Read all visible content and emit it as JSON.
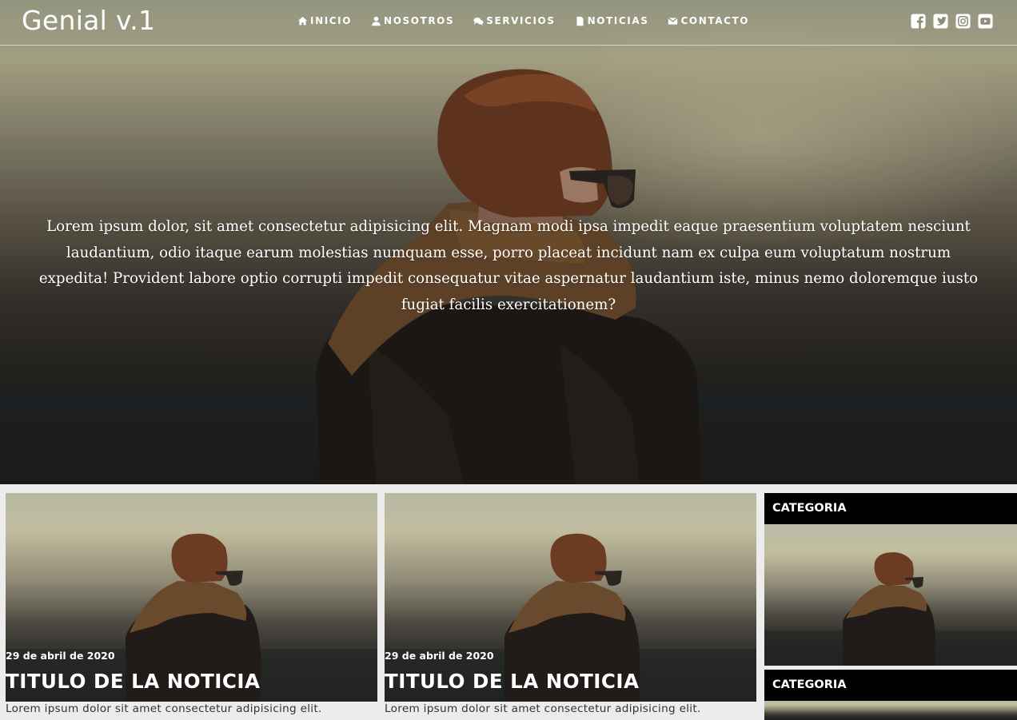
{
  "header": {
    "brand": "Genial v.1",
    "nav": [
      {
        "label": "INICIO",
        "icon": "home-icon"
      },
      {
        "label": "NOSOTROS",
        "icon": "user-icon"
      },
      {
        "label": "SERVICIOS",
        "icon": "comments-icon"
      },
      {
        "label": "NOTICIAS",
        "icon": "file-icon"
      },
      {
        "label": "CONTACTO",
        "icon": "envelope-icon"
      }
    ],
    "social": [
      "facebook-icon",
      "twitter-icon",
      "instagram-icon",
      "youtube-icon"
    ]
  },
  "hero": {
    "text": "Lorem ipsum dolor, sit amet consectetur adipisicing elit. Magnam modi ipsa impedit eaque praesentium voluptatem nesciunt laudantium, odio itaque earum molestias numquam esse, porro placeat incidunt nam ex culpa eum voluptatum nostrum expedita! Provident labore optio corrupti impedit consequatur vitae aspernatur laudantium iste, minus nemo doloremque iusto fugiat facilis exercitationem?"
  },
  "news": [
    {
      "date": "29 de abril de 2020",
      "title": "TITULO DE LA NOTICIA",
      "excerpt": "Lorem ipsum dolor sit amet consectetur adipisicing elit."
    },
    {
      "date": "29 de abril de 2020",
      "title": "TITULO DE LA NOTICIA",
      "excerpt": "Lorem ipsum dolor sit amet consectetur adipisicing elit."
    }
  ],
  "sidebar": {
    "categories": [
      {
        "label": "CATEGORIA"
      },
      {
        "label": "CATEGORIA"
      }
    ]
  },
  "colors": {
    "header_text": "#ffffff",
    "category_bar": "#000000",
    "page_bg": "#ececec",
    "excerpt_text": "#333333"
  }
}
